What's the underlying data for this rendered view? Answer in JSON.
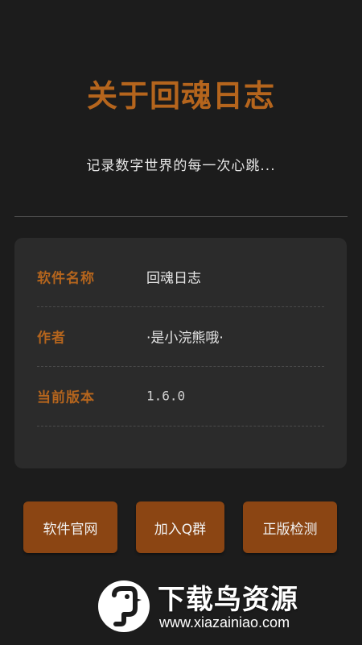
{
  "header": {
    "title": "关于回魂日志",
    "subtitle": "记录数字世界的每一次心跳..."
  },
  "info": {
    "rows": [
      {
        "label": "软件名称",
        "value": "回魂日志"
      },
      {
        "label": "作者",
        "value": "·是小浣熊哦·"
      },
      {
        "label": "当前版本",
        "value": "1.6.0"
      }
    ]
  },
  "actions": {
    "website": "软件官网",
    "join_qq": "加入Q群",
    "verify": "正版检测"
  },
  "watermark": {
    "name": "下载鸟资源",
    "url": "www.xiazainiao.com"
  },
  "colors": {
    "background": "#1c1c1c",
    "accent": "#b5651d",
    "button": "#8b4513",
    "card": "#2b2b2b"
  }
}
